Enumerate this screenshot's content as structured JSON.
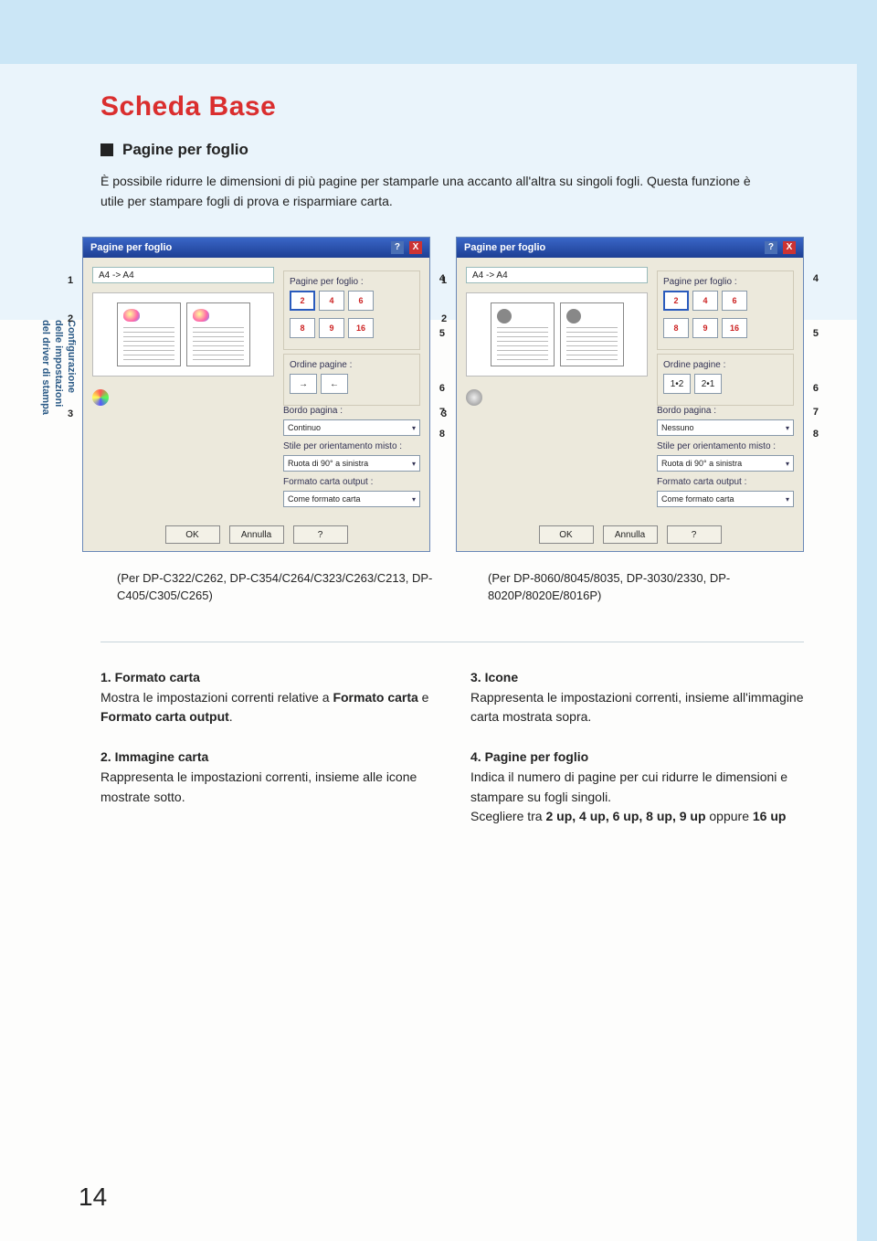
{
  "page_number": "14",
  "title": "Scheda Base",
  "subheading": "Pagine per foglio",
  "intro": "È possibile ridurre le dimensioni di più pagine per stamparle una accanto all'altra su singoli fogli. Questa funzione è utile per stampare fogli di prova e risparmiare carta.",
  "side_tab": {
    "line1": "Configurazione",
    "line2": "delle impostazioni",
    "line3": "del driver di stampa"
  },
  "dialog": {
    "title": "Pagine per foglio",
    "help_icon": "?",
    "close_icon": "X",
    "paper_value": "A4 -> A4",
    "grp_pages": "Pagine per foglio :",
    "thumbs": [
      "2",
      "4",
      "6",
      "8",
      "9",
      "16"
    ],
    "grp_order": "Ordine pagine :",
    "order_a_left": "1•2",
    "order_a_right": "2•1",
    "order_b_left": "→",
    "order_b_right": "←",
    "lbl_border": "Bordo pagina :",
    "border_a": "Continuo",
    "border_b": "Nessuno",
    "lbl_rotation": "Stile per orientamento misto :",
    "rotation_val": "Ruota di 90° a sinistra",
    "lbl_output": "Formato carta output :",
    "output_val": "Come formato carta",
    "btn_ok": "OK",
    "btn_cancel": "Annulla",
    "btn_help": "?"
  },
  "callouts": {
    "c1": "1",
    "c2": "2",
    "c3": "3",
    "c4": "4",
    "c5": "5",
    "c6": "6",
    "c7": "7",
    "c8": "8"
  },
  "caption_left": "(Per DP-C322/C262, DP-C354/C264/C323/C263/C213, DP-C405/C305/C265)",
  "caption_right": "(Per DP-8060/8045/8035, DP-3030/2330, DP-8020P/8020E/8016P)",
  "defs": {
    "d1": {
      "num": "1.",
      "key": "Formato carta",
      "body_a": "Mostra le impostazioni correnti relative a ",
      "bold1": "Formato carta",
      "mid": " e ",
      "bold2": "Formato carta output",
      "tail": "."
    },
    "d2": {
      "num": "2.",
      "key": "Immagine carta",
      "body": "Rappresenta le impostazioni correnti, insieme alle icone mostrate sotto."
    },
    "d3": {
      "num": "3.",
      "key": "Icone",
      "body": "Rappresenta le impostazioni correnti, insieme all'immagine carta mostrata sopra."
    },
    "d4": {
      "num": "4.",
      "key": "Pagine per foglio",
      "body": "Indica il numero di pagine per cui ridurre le dimensioni e stampare su fogli singoli.",
      "line2_a": "Scegliere tra ",
      "opts": "2 up, 4 up, 6 up, 8 up, 9 up",
      "line2_b": " oppure ",
      "opt_last": "16 up"
    }
  }
}
